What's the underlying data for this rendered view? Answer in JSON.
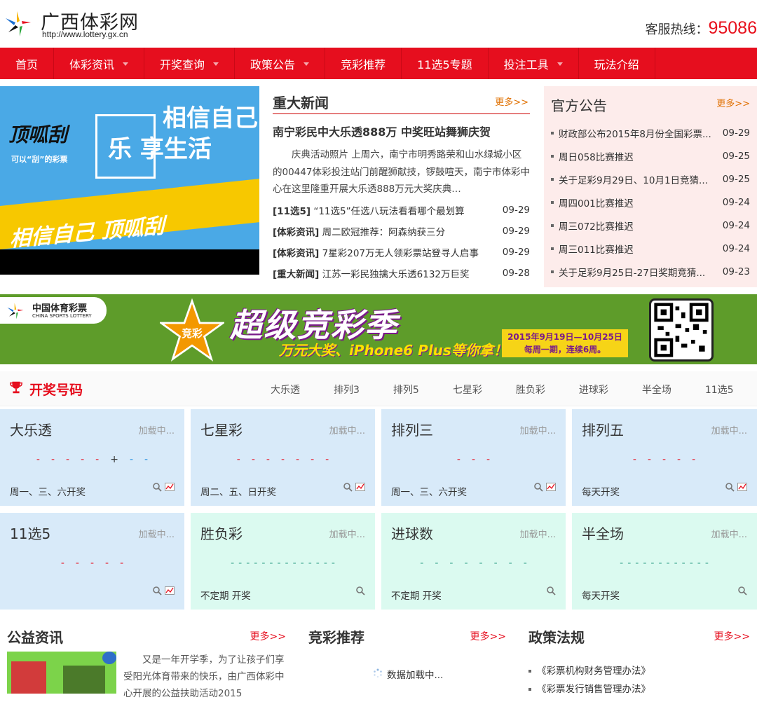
{
  "header": {
    "site_name": "广西体彩网",
    "site_url": "http://www.lottery.gx.cn",
    "hotline_label": "客服热线：",
    "hotline_number": "95086"
  },
  "nav": [
    {
      "label": "首页",
      "has_menu": false
    },
    {
      "label": "体彩资讯",
      "has_menu": true
    },
    {
      "label": "开奖查询",
      "has_menu": true
    },
    {
      "label": "政策公告",
      "has_menu": true
    },
    {
      "label": "竞彩推荐",
      "has_menu": false
    },
    {
      "label": "11选5专题",
      "has_menu": false
    },
    {
      "label": "投注工具",
      "has_menu": true
    },
    {
      "label": "玩法介绍",
      "has_menu": false
    }
  ],
  "banner": {
    "brand": "顶呱刮",
    "slogan": "可以“刮”的彩票",
    "line1": "相信自己",
    "line2": "乐 享生活",
    "line3": "相信自己 顶呱刮"
  },
  "news": {
    "title": "重大新闻",
    "more": "更多>>",
    "headline": "南宁彩民中大乐透888万 中奖旺站舞狮庆贺",
    "summary": "庆典活动照片 上周六，南宁市明秀路荣和山水绿城小区的00447体彩投注站门前醒狮献技，锣鼓喧天，南宁市体彩中心在这里隆重开展大乐透888万元大奖庆典…",
    "items": [
      {
        "cat": "[11选5]",
        "title": "“11选5”任选八玩法看看哪个最划算",
        "date": "09-29"
      },
      {
        "cat": "[体彩资讯]",
        "title": "周二欧冠推荐：阿森纳获三分",
        "date": "09-29"
      },
      {
        "cat": "[体彩资讯]",
        "title": "7星彩207万无人领彩票站登寻人启事",
        "date": "09-29"
      },
      {
        "cat": "[重大新闻]",
        "title": "江苏一彩民独擒大乐透6132万巨奖",
        "date": "09-28"
      }
    ]
  },
  "notice": {
    "title": "官方公告",
    "more": "更多>>",
    "items": [
      {
        "title": "财政部公布2015年8月份全国彩票...",
        "date": "09-29"
      },
      {
        "title": "周日058比赛推迟",
        "date": "09-25"
      },
      {
        "title": "关于足彩9月29日、10月1日竞猜...",
        "date": "09-25"
      },
      {
        "title": "周四001比赛推迟",
        "date": "09-24"
      },
      {
        "title": "周三072比赛推迟",
        "date": "09-24"
      },
      {
        "title": "周三011比赛推迟",
        "date": "09-24"
      },
      {
        "title": "关于足彩9月25日-27日奖期竞猜...",
        "date": "09-23"
      }
    ]
  },
  "promo": {
    "org_cn": "中国体育彩票",
    "org_en": "CHINA SPORTS LOTTERY",
    "star_text": "竞彩",
    "main": "超级竞彩季",
    "sub": "万元大奖、iPhone6 Plus等你拿！",
    "date_line1": "2015年9月19日—10月25日",
    "date_line2": "每周一期，连续6周。"
  },
  "results": {
    "title": "开奖号码",
    "tabs": [
      "大乐透",
      "排列3",
      "排列5",
      "七星彩",
      "胜负彩",
      "进球彩",
      "半全场",
      "11选5"
    ],
    "loading": "加载中...",
    "cards": [
      {
        "name": "大乐透",
        "sched": "周一、三、六开奖"
      },
      {
        "name": "七星彩",
        "sched": "周二、五、日开奖"
      },
      {
        "name": "排列三",
        "sched": "周一、三、六开奖"
      },
      {
        "name": "排列五",
        "sched": "每天开奖"
      },
      {
        "name": "11选5",
        "sched": ""
      },
      {
        "name": "胜负彩",
        "sched": "不定期 开奖"
      },
      {
        "name": "进球数",
        "sched": "不定期 开奖"
      },
      {
        "name": "半全场",
        "sched": "每天开奖"
      }
    ],
    "dash": "-",
    "plus": "+"
  },
  "welfare": {
    "title": "公益资讯",
    "more": "更多>>",
    "text": "又是一年开学季，为了让孩子们享受阳光体育带来的快乐，由广西体彩中心开展的公益扶助活动2015"
  },
  "recommend": {
    "title": "竞彩推荐",
    "more": "更多>>",
    "loading": "数据加载中..."
  },
  "policy": {
    "title": "政策法规",
    "more": "更多>>",
    "items": [
      "《彩票机构财务管理办法》",
      "《彩票发行销售管理办法》"
    ]
  },
  "colors": {
    "brand_red": "#e60e1e",
    "card_blue": "#d8eaf9",
    "card_green": "#dbfaf0",
    "notice_bg": "#fdeceb"
  }
}
